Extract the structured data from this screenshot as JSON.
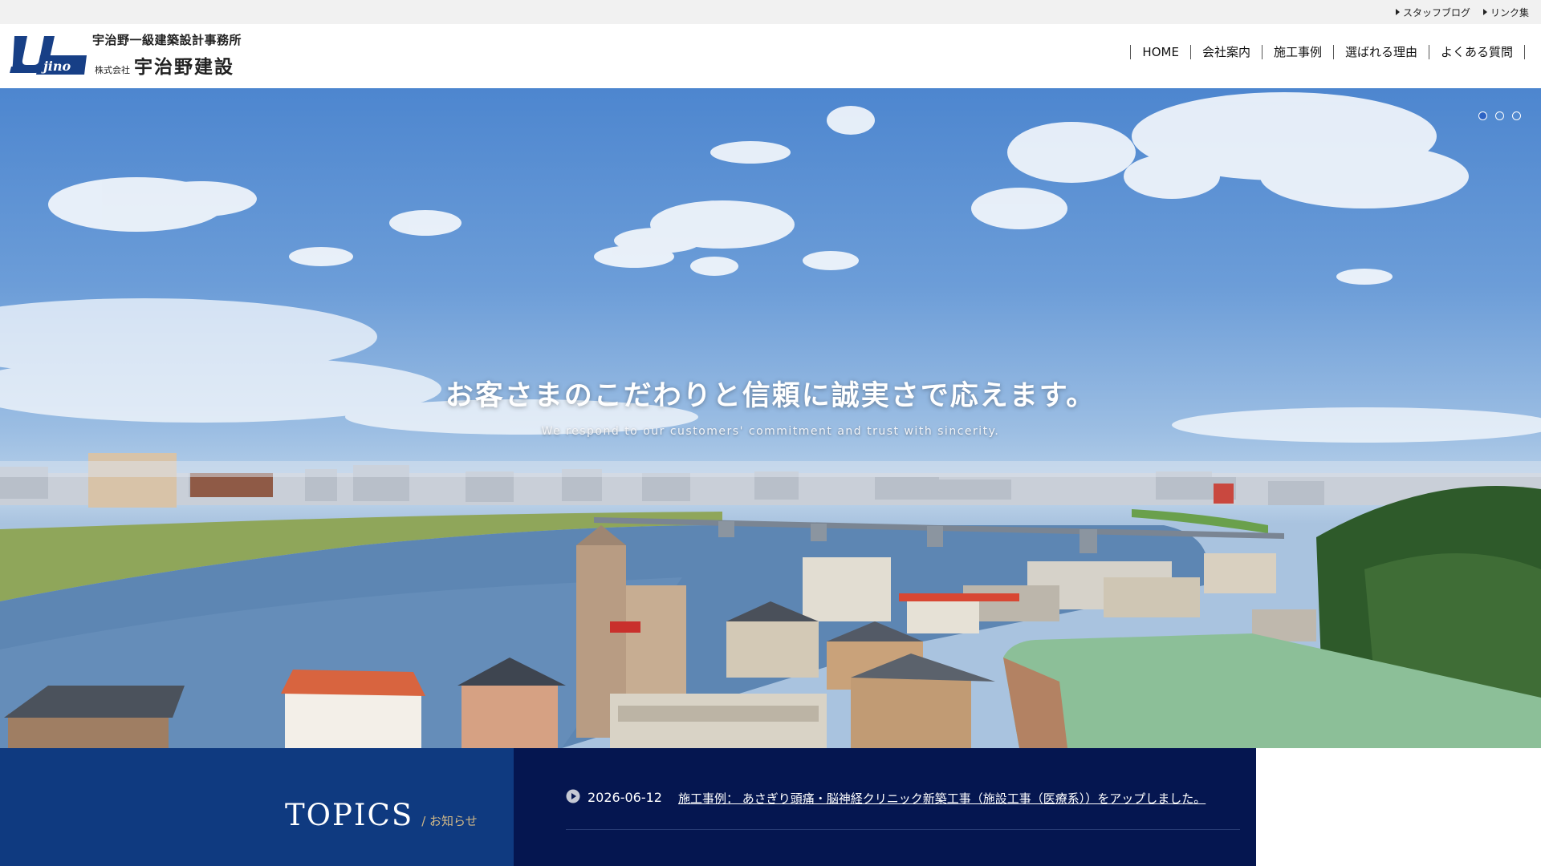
{
  "utility_links": [
    {
      "label": "スタッフブログ"
    },
    {
      "label": "リンク集"
    }
  ],
  "logo": {
    "sub": "宇治野一級建築設計事務所",
    "kabu": "株式会社",
    "main": "宇治野建設"
  },
  "nav": [
    {
      "label": "HOME"
    },
    {
      "label": "会社案内"
    },
    {
      "label": "施工事例"
    },
    {
      "label": "選ばれる理由"
    },
    {
      "label": "よくある質問"
    }
  ],
  "hero": {
    "title": "お客さまのこだわりと信頼に誠実さで応えます。",
    "subtitle": "We respond to our customers' commitment and trust with sincerity.",
    "slides": 3,
    "active_slide": 1
  },
  "topics": {
    "heading_en": "TOPICS",
    "heading_ja": "/ お知らせ",
    "items": [
      {
        "date": "2026-06-12",
        "text": "施工事例： あさぎり頭痛・脳神経クリニック新築工事（施設工事（医療系））をアップしました。"
      }
    ]
  },
  "colors": {
    "topics_left_bg": "#0f3a80",
    "topics_right_bg": "#051650",
    "topics_ja_accent": "#d2b987",
    "slider_active": "#2d63c4"
  }
}
